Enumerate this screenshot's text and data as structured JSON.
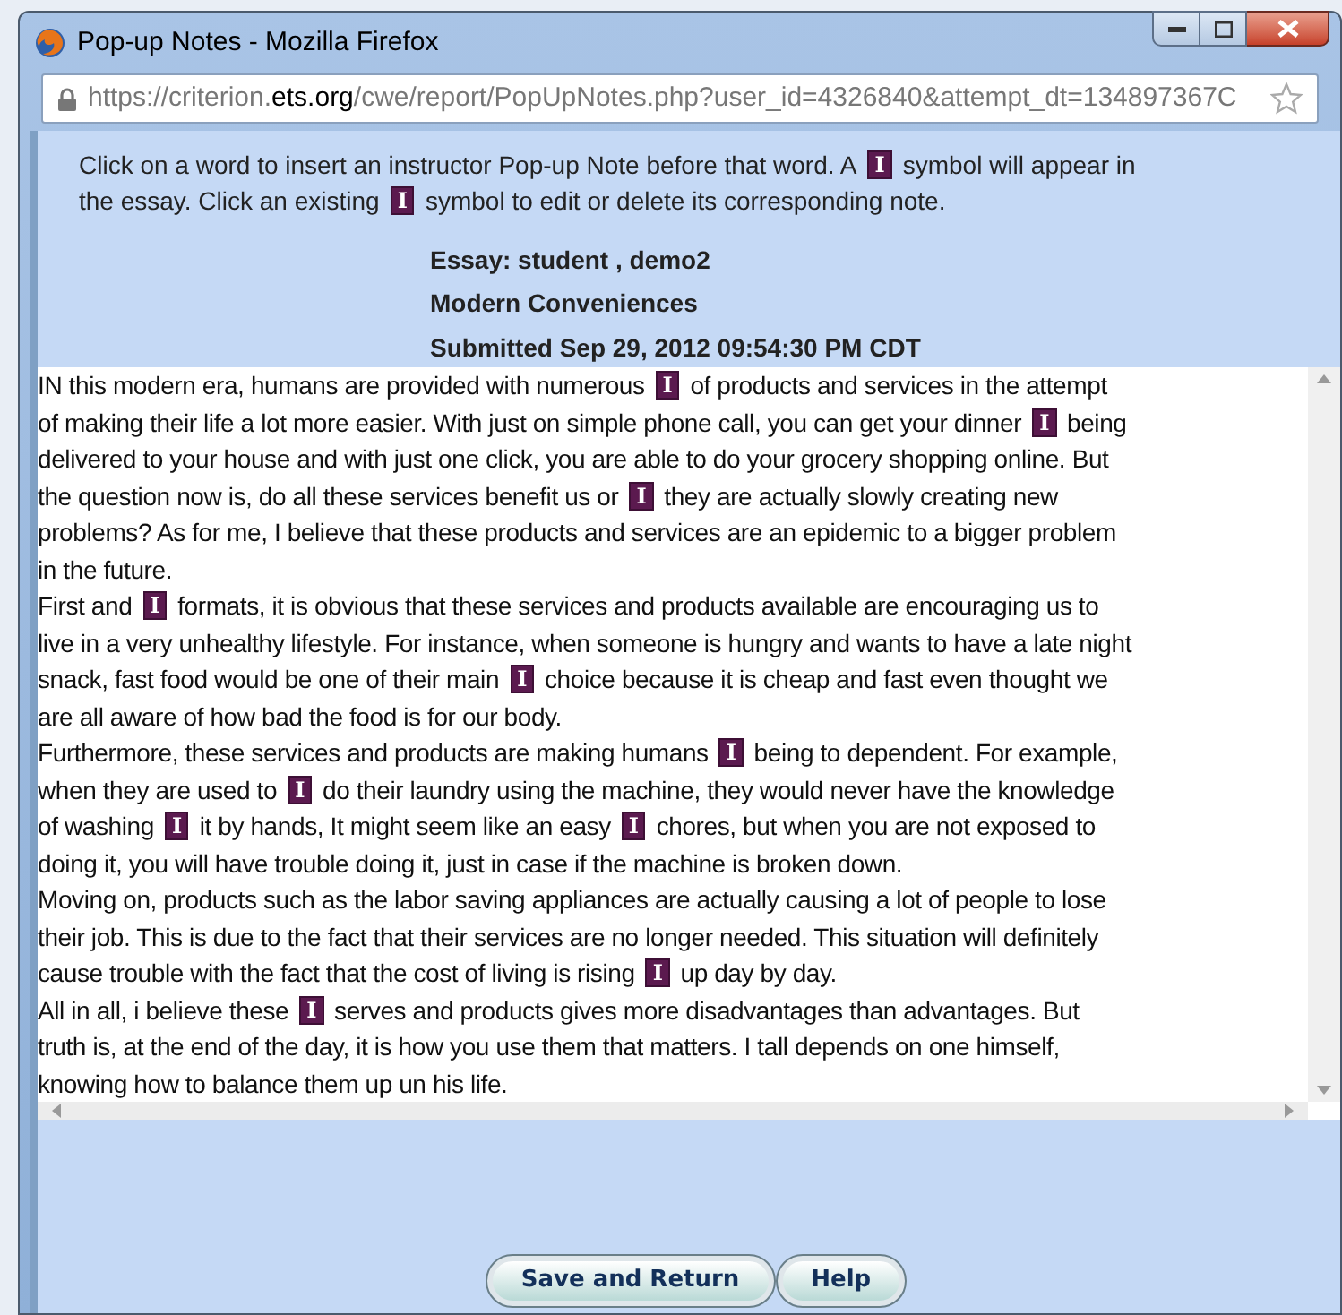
{
  "window": {
    "title": "Pop-up Notes - Mozilla Firefox"
  },
  "address_bar": {
    "url_start": "https://criterion.",
    "url_domain": "ets.org",
    "url_rest": "/cwe/report/PopUpNotes.php?user_id=4326840&attempt_dt=134897367C"
  },
  "instructions": [
    [
      {
        "kind": "text",
        "text": "Click on a word to insert an instructor Pop-up Note before that word. A"
      },
      {
        "kind": "note",
        "text": "I"
      },
      {
        "kind": "text",
        "text": "symbol will appear in"
      }
    ],
    [
      {
        "kind": "text",
        "text": "the essay. Click an existing"
      },
      {
        "kind": "note",
        "text": "I"
      },
      {
        "kind": "text",
        "text": "symbol to edit or delete its corresponding note."
      }
    ]
  ],
  "essay_header": {
    "essay": "Essay: student , demo2",
    "title": "Modern Conveniences",
    "submitted": "Submitted Sep 29, 2012 09:54:30 PM CDT"
  },
  "essay_lines": [
    [
      {
        "kind": "text",
        "text": "IN this modern era, humans are provided with numerous"
      },
      {
        "kind": "note",
        "text": "I"
      },
      {
        "kind": "text",
        "text": "of products and services in the attempt"
      }
    ],
    [
      {
        "kind": "text",
        "text": "of making their life a lot more easier. With just on simple phone call, you can get your dinner"
      },
      {
        "kind": "note",
        "text": "I"
      },
      {
        "kind": "text",
        "text": "being"
      }
    ],
    [
      {
        "kind": "text",
        "text": "delivered to your house and with just one click, you are able to do your grocery shopping online. But"
      }
    ],
    [
      {
        "kind": "text",
        "text": "the question now is, do all these services benefit us or"
      },
      {
        "kind": "note",
        "text": "I"
      },
      {
        "kind": "text",
        "text": "they are actually slowly creating new"
      }
    ],
    [
      {
        "kind": "text",
        "text": "problems? As for me, I believe that these products and services are an epidemic to a bigger problem"
      }
    ],
    [
      {
        "kind": "text",
        "text": "in the future."
      }
    ],
    [
      {
        "kind": "text",
        "text": "First and"
      },
      {
        "kind": "note",
        "text": "I"
      },
      {
        "kind": "text",
        "text": "formats, it is obvious that these services and products available are encouraging us to"
      }
    ],
    [
      {
        "kind": "text",
        "text": "live in a very unhealthy lifestyle. For instance, when someone is hungry and wants to have a late night"
      }
    ],
    [
      {
        "kind": "text",
        "text": "snack, fast food would be one of their main"
      },
      {
        "kind": "note",
        "text": "I"
      },
      {
        "kind": "text",
        "text": "choice because it is cheap and fast even thought we"
      }
    ],
    [
      {
        "kind": "text",
        "text": "are all aware of how bad the food is for our body."
      }
    ],
    [
      {
        "kind": "text",
        "text": "Furthermore, these services and products are making humans"
      },
      {
        "kind": "note",
        "text": "I"
      },
      {
        "kind": "text",
        "text": "being to dependent. For example,"
      }
    ],
    [
      {
        "kind": "text",
        "text": "when they are used to"
      },
      {
        "kind": "note",
        "text": "I"
      },
      {
        "kind": "text",
        "text": "do their laundry using the machine, they would never have the knowledge"
      }
    ],
    [
      {
        "kind": "text",
        "text": "of washing"
      },
      {
        "kind": "note",
        "text": "I"
      },
      {
        "kind": "text",
        "text": "it by hands, It might seem like an easy"
      },
      {
        "kind": "note",
        "text": "I"
      },
      {
        "kind": "text",
        "text": "chores, but when you are not exposed to"
      }
    ],
    [
      {
        "kind": "text",
        "text": "doing it, you will have trouble doing it, just in case if the machine is broken down."
      }
    ],
    [
      {
        "kind": "text",
        "text": "Moving on, products such as the labor saving appliances are actually causing a lot of people to lose"
      }
    ],
    [
      {
        "kind": "text",
        "text": "their job. This is due to the fact that their services are no longer needed. This situation will definitely"
      }
    ],
    [
      {
        "kind": "text",
        "text": "cause trouble with the fact that the cost of living is rising"
      },
      {
        "kind": "note",
        "text": "I"
      },
      {
        "kind": "text",
        "text": "up day by day."
      }
    ],
    [
      {
        "kind": "text",
        "text": "All in all, i believe these"
      },
      {
        "kind": "note",
        "text": "I"
      },
      {
        "kind": "text",
        "text": "serves and products gives more disadvantages than advantages. But"
      }
    ],
    [
      {
        "kind": "text",
        "text": "truth is, at the end of the day, it is how you use them that matters. I tall depends on one himself,"
      }
    ],
    [
      {
        "kind": "text",
        "text": "knowing how to balance them up un his life."
      }
    ]
  ],
  "buttons": [
    {
      "label": "Save and Return"
    },
    {
      "label": "Help"
    }
  ]
}
